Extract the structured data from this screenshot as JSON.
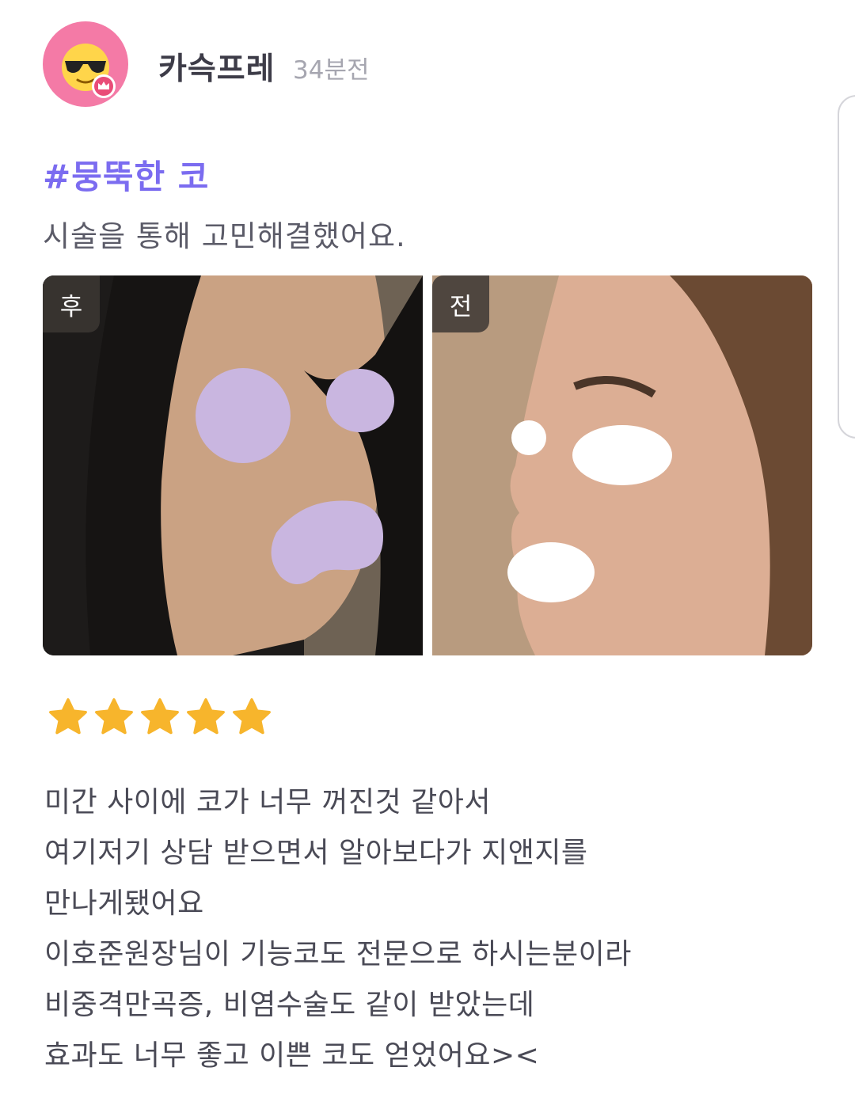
{
  "post": {
    "username": "카슥프레",
    "time": "34분전",
    "hashtag": "#뭉뚝한 코",
    "subtitle": "시술을 통해 고민해결했어요."
  },
  "photos": {
    "after_label": "후",
    "before_label": "전"
  },
  "rating": {
    "stars": 5,
    "max": 5,
    "star_color": "#f7b52c"
  },
  "review": {
    "lines": [
      "미간 사이에 코가 너무 꺼진것 같아서",
      "여기저기 상담 받으면서 알아보다가 지앤지를",
      "만나게됐어요",
      "이호준원장님이 기능코도 전문으로 하시는분이라",
      "비중격만곡증, 비염수술도 같이 받았는데",
      "효과도 너무 좋고 이쁜 코도 얻었어요><"
    ]
  },
  "colors": {
    "accent": "#7b6cf0",
    "avatar_bg": "#f47aa6"
  },
  "icons": {
    "avatar": "sunglasses-face-icon",
    "crown": "crown-badge-icon",
    "star": "star-icon"
  }
}
